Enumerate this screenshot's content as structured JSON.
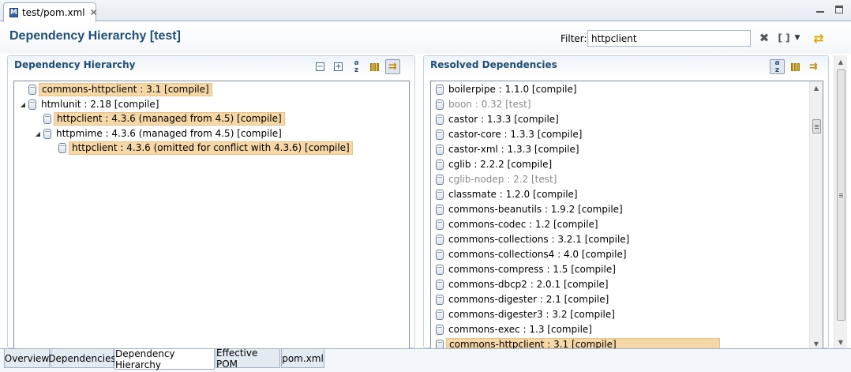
{
  "editor_tab": {
    "icon": "M",
    "label": "test/pom.xml",
    "close": "✕"
  },
  "window": {
    "minimize_icon": "minimize-icon",
    "maximize_icon": "maximize-icon"
  },
  "header": {
    "title": "Dependency Hierarchy [test]",
    "filter_label": "Filter:",
    "filter_value": "httpclient",
    "clear_icon": "✖",
    "brackets_icon": "[ ]",
    "dropdown_icon": "▼",
    "refresh_icon": "⇄"
  },
  "left": {
    "title": "Dependency Hierarchy",
    "tree": [
      {
        "label": "commons-httpclient : 3.1 [compile]",
        "level": 0,
        "twisty": "",
        "highlight": true
      },
      {
        "label": "htmlunit : 2.18 [compile]",
        "level": 0,
        "twisty": "◢",
        "highlight": false
      },
      {
        "label": "httpclient : 4.3.6 (managed from 4.5) [compile]",
        "level": 1,
        "twisty": "",
        "highlight": true
      },
      {
        "label": "httpmime : 4.3.6 (managed from 4.5) [compile]",
        "level": 1,
        "twisty": "◢",
        "highlight": false
      },
      {
        "label": "httpclient : 4.3.6 (omitted for conflict with 4.3.6) [compile]",
        "level": 2,
        "twisty": "",
        "highlight": true
      }
    ]
  },
  "right": {
    "title": "Resolved Dependencies",
    "items": [
      {
        "label": "boilerpipe : 1.1.0 [compile]",
        "dim": false,
        "highlight": false
      },
      {
        "label": "boon : 0.32 [test]",
        "dim": true,
        "highlight": false
      },
      {
        "label": "castor : 1.3.3 [compile]",
        "dim": false,
        "highlight": false
      },
      {
        "label": "castor-core : 1.3.3 [compile]",
        "dim": false,
        "highlight": false
      },
      {
        "label": "castor-xml : 1.3.3 [compile]",
        "dim": false,
        "highlight": false
      },
      {
        "label": "cglib : 2.2.2 [compile]",
        "dim": false,
        "highlight": false
      },
      {
        "label": "cglib-nodep : 2.2 [test]",
        "dim": true,
        "highlight": false
      },
      {
        "label": "classmate : 1.2.0 [compile]",
        "dim": false,
        "highlight": false
      },
      {
        "label": "commons-beanutils : 1.9.2 [compile]",
        "dim": false,
        "highlight": false
      },
      {
        "label": "commons-codec : 1.2 [compile]",
        "dim": false,
        "highlight": false
      },
      {
        "label": "commons-collections : 3.2.1 [compile]",
        "dim": false,
        "highlight": false
      },
      {
        "label": "commons-collections4 : 4.0 [compile]",
        "dim": false,
        "highlight": false
      },
      {
        "label": "commons-compress : 1.5 [compile]",
        "dim": false,
        "highlight": false
      },
      {
        "label": "commons-dbcp2 : 2.0.1 [compile]",
        "dim": false,
        "highlight": false
      },
      {
        "label": "commons-digester : 2.1 [compile]",
        "dim": false,
        "highlight": false
      },
      {
        "label": "commons-digester3 : 3.2 [compile]",
        "dim": false,
        "highlight": false
      },
      {
        "label": "commons-exec : 1.3 [compile]",
        "dim": false,
        "highlight": false
      },
      {
        "label": "commons-httpclient : 3.1 [compile]",
        "dim": false,
        "highlight": true
      }
    ]
  },
  "tools": {
    "collapse": "−",
    "expand": "+",
    "sort": [
      "a",
      "z"
    ]
  },
  "scroll": {
    "up": "▲",
    "down": "▼"
  },
  "page_tabs": [
    {
      "label": "Overview",
      "active": false
    },
    {
      "label": "Dependencies",
      "active": false
    },
    {
      "label": "Dependency Hierarchy",
      "active": true
    },
    {
      "label": "Effective POM",
      "active": false
    },
    {
      "label": "pom.xml",
      "active": false
    }
  ],
  "colors": {
    "title": "#1f4e79",
    "highlight": "#f6d8a6",
    "dim_text": "#8a8a8a"
  }
}
